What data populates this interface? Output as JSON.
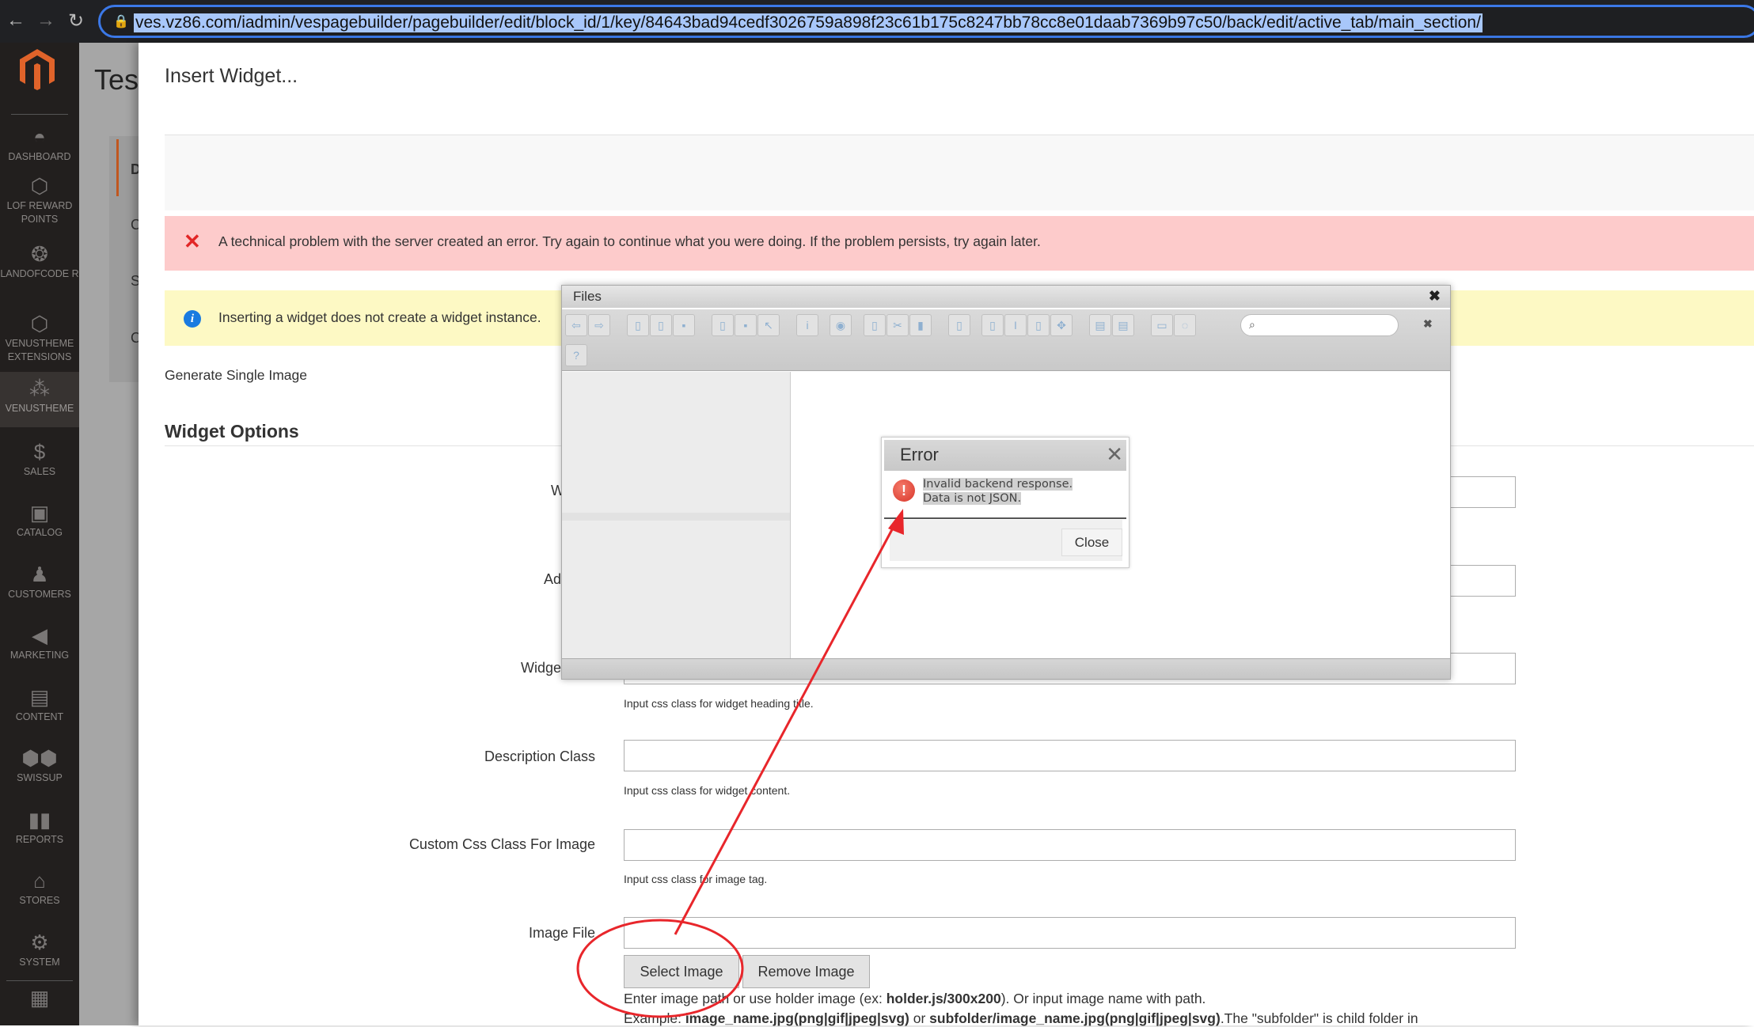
{
  "browser": {
    "url": "ves.vz86.com/iadmin/vespagebuilder/pagebuilder/edit/block_id/1/key/84643bad94cedf3026759a898f23c61b175c8247bb78cc8e01daab7369b97c50/back/edit/active_tab/main_section/"
  },
  "sidebar": {
    "items": [
      {
        "label": "DASHBOARD",
        "icon": "dashboard-icon"
      },
      {
        "label": "LOF REWARD POINTS",
        "icon": "hexagon-icon"
      },
      {
        "label": "LANDOFCODE R",
        "icon": "landofcoder-icon"
      },
      {
        "label": "VENUSTHEME EXTENSIONS",
        "icon": "hexagon-icon"
      },
      {
        "label": "VENUSTHEME",
        "icon": "stars-icon",
        "active": true
      },
      {
        "label": "SALES",
        "icon": "dollar-icon"
      },
      {
        "label": "CATALOG",
        "icon": "box-icon"
      },
      {
        "label": "CUSTOMERS",
        "icon": "person-icon"
      },
      {
        "label": "MARKETING",
        "icon": "megaphone-icon"
      },
      {
        "label": "CONTENT",
        "icon": "layout-icon"
      },
      {
        "label": "SWISSUP",
        "icon": "swissup-icon"
      },
      {
        "label": "REPORTS",
        "icon": "bar-chart-icon"
      },
      {
        "label": "STORES",
        "icon": "store-icon"
      },
      {
        "label": "SYSTEM",
        "icon": "gear-icon"
      }
    ]
  },
  "background": {
    "page_title": "Tes",
    "tabs": [
      "D",
      "C",
      "S",
      "C"
    ]
  },
  "modal": {
    "title": "Insert Widget...",
    "error_message": "A technical problem with the server created an error. Try again to continue what you were doing. If the problem persists, try again later.",
    "info_message": "Inserting a widget does not create a widget instance.",
    "widget_type": "Generate Single Image",
    "section_title": "Widget Options",
    "fields": [
      {
        "label": "Widget",
        "value": ""
      },
      {
        "label": "Addition",
        "value": ""
      },
      {
        "label": "Widget Title",
        "value": "",
        "note": "Input css class for widget heading title."
      },
      {
        "label": "Description Class",
        "value": "",
        "note": "Input css class for widget content."
      },
      {
        "label": "Custom Css Class For Image",
        "value": "",
        "note": "Input css class for image tag."
      },
      {
        "label": "Image File",
        "value": ""
      }
    ],
    "select_image": "Select Image",
    "remove_image": "Remove Image",
    "help1_a": "Enter image path or use holder image (ex: ",
    "help1_b": "holder.js/300x200",
    "help1_c": "). Or input image name with path.",
    "help2_a": "Example: ",
    "help2_b": "image_name.jpg(png|gif|jpeg|svg)",
    "help2_c": " or ",
    "help2_d": "subfolder/image_name.jpg(png|gif|jpeg|svg)",
    "help2_e": ".The \"subfolder\" is child folder in"
  },
  "files_dialog": {
    "title": "Files",
    "search_placeholder": "",
    "close": "✖"
  },
  "error_dialog": {
    "title": "Error",
    "line1": "Invalid backend response.",
    "line2": "Data is not JSON.",
    "close_label": "Close"
  },
  "annotation_color": "#e8262b"
}
